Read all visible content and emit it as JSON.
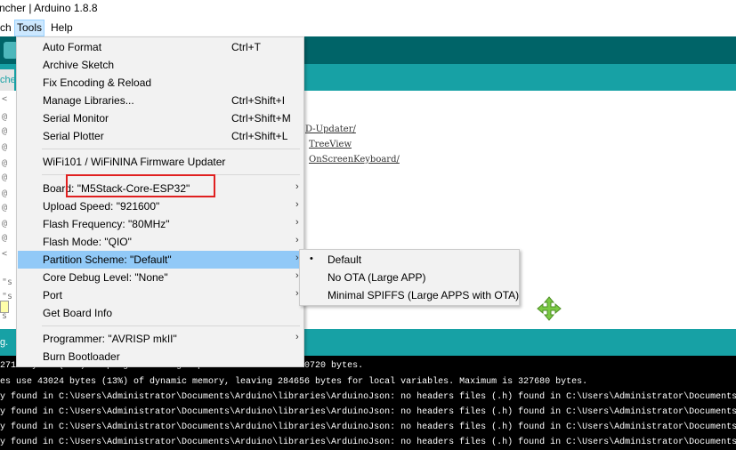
{
  "window": {
    "title": "ncher | Arduino 1.8.8"
  },
  "menubar": {
    "items": [
      "ch",
      "Tools",
      "Help"
    ]
  },
  "tab": {
    "label": "che"
  },
  "editor": {
    "gutter_marks": [
      "<",
      "@",
      "@",
      "@",
      "@",
      "@",
      "@",
      "@",
      "@",
      "@",
      "<"
    ],
    "links": [
      "D-Updater/",
      "TreeView",
      "OnScreenKeyboard/"
    ],
    "fragments": [
      "\"s",
      "\"s",
      "s"
    ]
  },
  "status": {
    "text": "g."
  },
  "tools_menu": {
    "items": [
      {
        "label": "Auto Format",
        "shortcut": "Ctrl+T"
      },
      {
        "label": "Archive Sketch",
        "shortcut": ""
      },
      {
        "label": "Fix Encoding & Reload",
        "shortcut": ""
      },
      {
        "label": "Manage Libraries...",
        "shortcut": "Ctrl+Shift+I"
      },
      {
        "label": "Serial Monitor",
        "shortcut": "Ctrl+Shift+M"
      },
      {
        "label": "Serial Plotter",
        "shortcut": "Ctrl+Shift+L"
      },
      {
        "label": "WiFi101 / WiFiNINA Firmware Updater",
        "shortcut": ""
      },
      {
        "label": "Board: \"M5Stack-Core-ESP32\"",
        "shortcut": ""
      },
      {
        "label": "Upload Speed: \"921600\"",
        "shortcut": ""
      },
      {
        "label": "Flash Frequency: \"80MHz\"",
        "shortcut": ""
      },
      {
        "label": "Flash Mode: \"QIO\"",
        "shortcut": ""
      },
      {
        "label": "Partition Scheme: \"Default\"",
        "shortcut": ""
      },
      {
        "label": "Core Debug Level: \"None\"",
        "shortcut": ""
      },
      {
        "label": "Port",
        "shortcut": ""
      },
      {
        "label": "Get Board Info",
        "shortcut": ""
      },
      {
        "label": "Programmer: \"AVRISP mkII\"",
        "shortcut": ""
      },
      {
        "label": "Burn Bootloader",
        "shortcut": ""
      }
    ],
    "arrow": "›"
  },
  "partition_submenu": {
    "items": [
      {
        "label": "Default",
        "selected_mark": "•"
      },
      {
        "label": "No OTA (Large APP)",
        "selected_mark": ""
      },
      {
        "label": "Minimal SPIFFS (Large APPS with OTA)",
        "selected_mark": ""
      }
    ]
  },
  "console": {
    "lines": [
      "2716 bytes (71%) of program storage space. Maximum is 1310720 bytes.",
      "es use 43024 bytes (13%) of dynamic memory, leaving 284656 bytes for local variables. Maximum is 327680 bytes.",
      "y found in C:\\Users\\Administrator\\Documents\\Arduino\\libraries\\ArduinoJson: no headers files (.h) found in C:\\Users\\Administrator\\Documents\\Arduino\\libr",
      "y found in C:\\Users\\Administrator\\Documents\\Arduino\\libraries\\ArduinoJson: no headers files (.h) found in C:\\Users\\Administrator\\Documents\\Arduino\\libr",
      "y found in C:\\Users\\Administrator\\Documents\\Arduino\\libraries\\ArduinoJson: no headers files (.h) found in C:\\Users\\Administrator\\Documents\\Arduino\\libr",
      "y found in C:\\Users\\Administrator\\Documents\\Arduino\\libraries\\ArduinoJson: no headers files (.h) found in C:\\Users\\Administrator\\Documents\\Arduino\\libr"
    ]
  },
  "colors": {
    "toolbar": "#006468",
    "tabbar": "#17a1a5",
    "menu_highlight": "#91c9f7",
    "annotation_box": "#e02020",
    "move_icon": "#7ac943"
  }
}
